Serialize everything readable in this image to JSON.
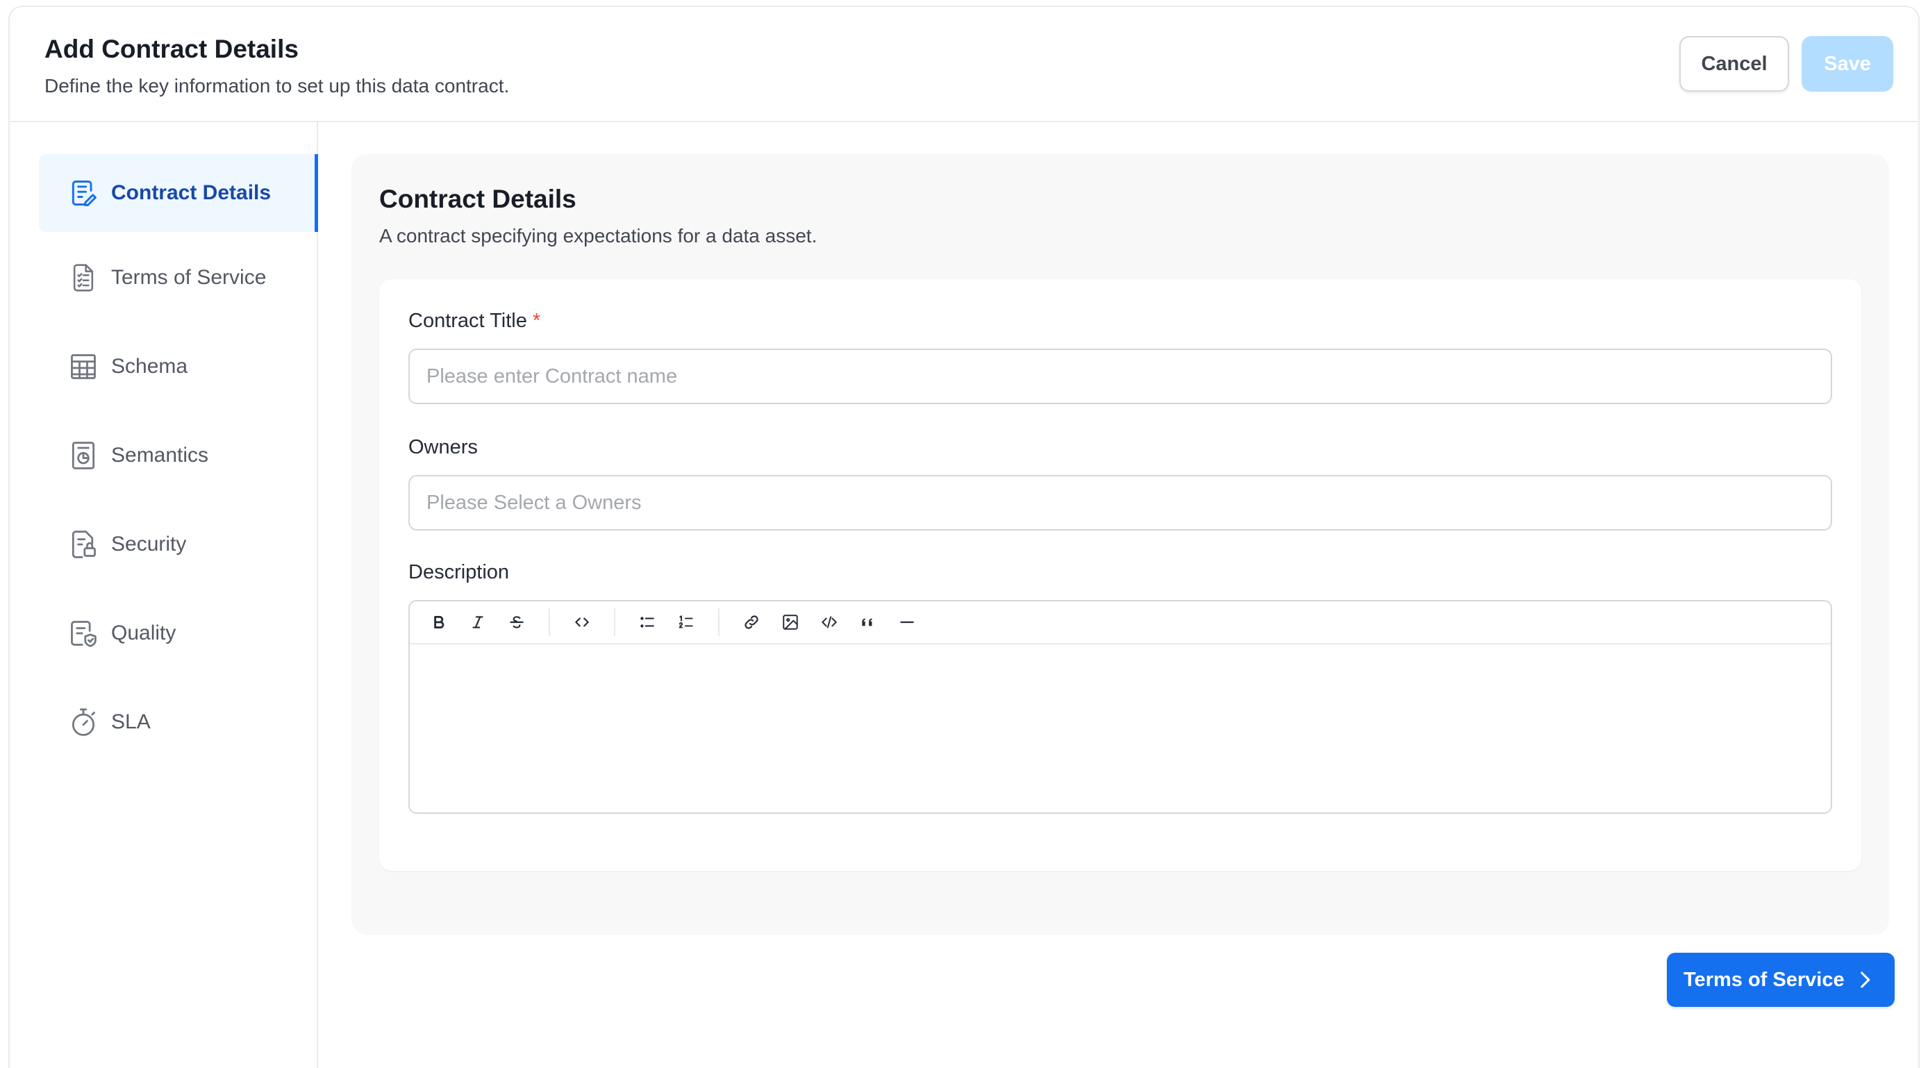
{
  "header": {
    "title": "Add Contract Details",
    "subtitle": "Define the key information to set up this data contract.",
    "cancel_label": "Cancel",
    "save_label": "Save"
  },
  "sidebar": {
    "items": [
      {
        "label": "Contract Details",
        "icon": "contract-edit-icon",
        "active": true
      },
      {
        "label": "Terms of Service",
        "icon": "document-list-icon",
        "active": false
      },
      {
        "label": "Schema",
        "icon": "table-grid-icon",
        "active": false
      },
      {
        "label": "Semantics",
        "icon": "document-pie-icon",
        "active": false
      },
      {
        "label": "Security",
        "icon": "document-lock-icon",
        "active": false
      },
      {
        "label": "Quality",
        "icon": "document-shield-icon",
        "active": false
      },
      {
        "label": "SLA",
        "icon": "stopwatch-icon",
        "active": false
      }
    ]
  },
  "main": {
    "section_title": "Contract Details",
    "section_subtitle": "A contract specifying expectations for a data asset.",
    "fields": {
      "title_label": "Contract Title",
      "title_required_mark": "*",
      "title_placeholder": "Please enter Contract name",
      "owners_label": "Owners",
      "owners_placeholder": "Please Select a Owners",
      "description_label": "Description"
    },
    "toolbar_icons": [
      "bold-icon",
      "italic-icon",
      "strikethrough-icon",
      "inline-code-icon",
      "bullet-list-icon",
      "numbered-list-icon",
      "link-icon",
      "image-icon",
      "code-block-icon",
      "quote-icon",
      "horizontal-rule-icon"
    ],
    "next_button_label": "Terms of Service"
  },
  "colors": {
    "accent": "#1570ef",
    "active_nav_bg": "#eff8ff",
    "active_nav_text": "#1849a9",
    "save_disabled": "#b2ddff",
    "required": "#f04438"
  }
}
